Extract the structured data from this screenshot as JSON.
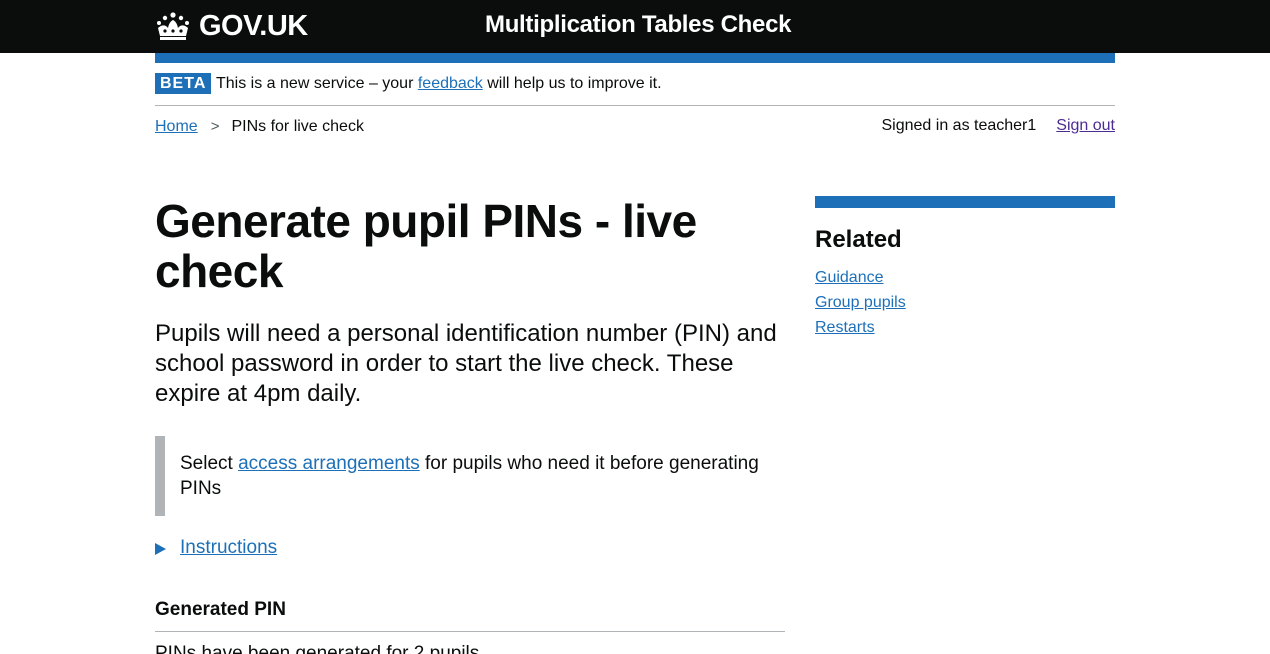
{
  "header": {
    "logo_text": "GOV.UK",
    "service_name": "Multiplication Tables Check"
  },
  "phase_banner": {
    "tag": "BETA",
    "text_before": "This is a new service – your ",
    "link_text": "feedback",
    "text_after": " will help us to improve it."
  },
  "breadcrumb": {
    "home": "Home",
    "separator": ">",
    "current": "PINs for live check"
  },
  "user": {
    "signed_in_text": "Signed in as teacher1",
    "sign_out": "Sign out"
  },
  "main": {
    "title": "Generate pupil PINs - live check",
    "lead": "Pupils will need a personal identification number (PIN) and school password in order to start the live check. These expire at 4pm daily.",
    "inset_before": "Select ",
    "inset_link": "access arrangements",
    "inset_after": " for pupils who need it before generating PINs",
    "details_summary": "Instructions",
    "generated_heading": "Generated PIN",
    "generated_text": "PINs have been generated for 2 pupils"
  },
  "related": {
    "title": "Related",
    "links": [
      "Guidance",
      "Group pupils",
      "Restarts"
    ]
  },
  "colors": {
    "header_bg": "#0b0c0c",
    "brand_blue": "#1d70b8",
    "visited_link": "#4c2c92",
    "border_grey": "#b1b4b6"
  }
}
